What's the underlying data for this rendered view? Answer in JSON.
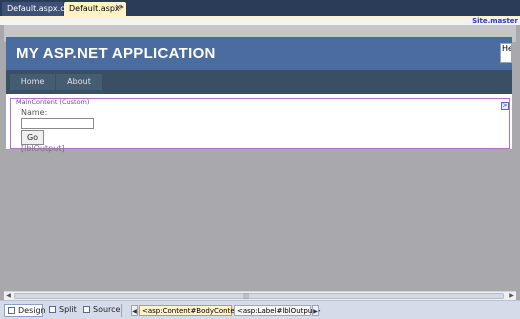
{
  "tabs": [
    {
      "label": "Default.aspx.cs",
      "active": false
    },
    {
      "label": "Default.aspx*",
      "active": true,
      "close": "×"
    }
  ],
  "designer": {
    "master_link": "Site.master",
    "app_title": "MY ASP.NET APPLICATION",
    "login_text": "He",
    "menu": [
      "Home",
      "About"
    ],
    "region_label": "MainContent (Custom)",
    "smart_tag": ">",
    "name_label": "Name:",
    "name_value": "",
    "go_button": "Go",
    "output_label": "[lblOutput]"
  },
  "scrollbar": {
    "left": "◀",
    "right": "▶",
    "grip": "|||"
  },
  "viewbar": {
    "design": "Design",
    "split": "Split",
    "source": "Source",
    "nav_left": "◀",
    "nav_right": "▶",
    "breadcrumbs": [
      "<asp:Content#BodyContent>",
      "<asp:Label#lblOutput>"
    ]
  },
  "colors": {
    "header": "#4b6c9e",
    "menu": "#3a4f63",
    "region_border": "#b36fd4",
    "tab_active": "#fff3c8",
    "tab_strip": "#2b3c59"
  }
}
